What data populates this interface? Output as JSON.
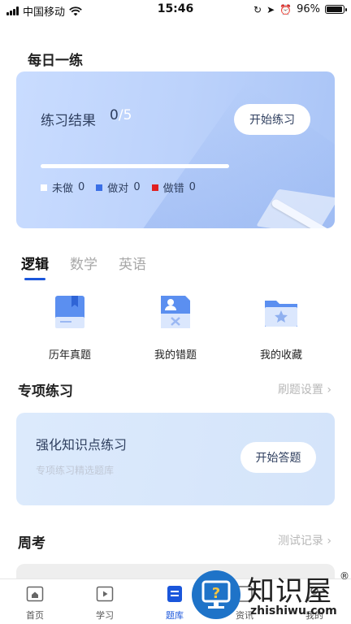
{
  "status_bar": {
    "carrier": "中国移动",
    "time": "15:46",
    "battery": "96%",
    "battery_level": 0.96
  },
  "daily": {
    "title": "每日一练",
    "result_label": "练习结果",
    "done": "0",
    "slash": "/",
    "total": "5",
    "start_button": "开始练习",
    "legend": [
      {
        "label": "未做",
        "count": "0",
        "color": "#ffffff"
      },
      {
        "label": "做对",
        "count": "0",
        "color": "#3a6fe6"
      },
      {
        "label": "做错",
        "count": "0",
        "color": "#e02020"
      }
    ],
    "progress": 0
  },
  "tabs": [
    {
      "label": "逻辑",
      "active": true
    },
    {
      "label": "数学",
      "active": false
    },
    {
      "label": "英语",
      "active": false
    }
  ],
  "quick_entries": [
    {
      "label": "历年真题",
      "icon": "book-icon"
    },
    {
      "label": "我的错题",
      "icon": "wrong-questions-icon"
    },
    {
      "label": "我的收藏",
      "icon": "folder-star-icon"
    }
  ],
  "special": {
    "title": "专项练习",
    "settings_link": "刷题设置",
    "card_title": "强化知识点练习",
    "card_subtitle": "专项练习精选题库",
    "answer_button": "开始答题"
  },
  "weekly": {
    "title": "周考",
    "records_link": "测试记录"
  },
  "bottom_nav": [
    {
      "label": "首页",
      "icon": "home-icon",
      "active": false
    },
    {
      "label": "学习",
      "icon": "play-icon",
      "active": false
    },
    {
      "label": "题库",
      "icon": "question-bank-icon",
      "active": true
    },
    {
      "label": "资讯",
      "icon": "news-icon",
      "active": false
    },
    {
      "label": "我的",
      "icon": "profile-icon",
      "active": false
    }
  ],
  "watermark": {
    "brand": "知识屋",
    "reg": "®",
    "url": "zhishiwu.com",
    "glyph": "?"
  },
  "colors": {
    "accent": "#1a56db",
    "card_blue": "#bcd2fb",
    "wrong_red": "#e02020"
  }
}
